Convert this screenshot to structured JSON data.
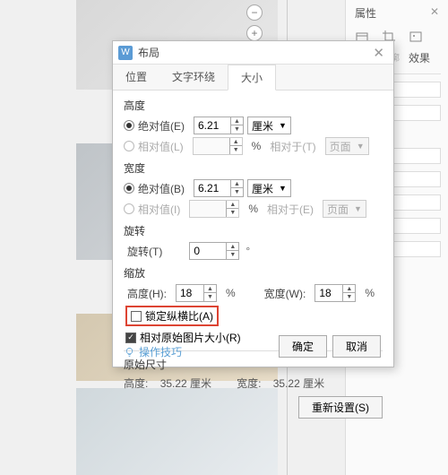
{
  "toolbar": {
    "zoom_out": "−",
    "zoom_in": "+"
  },
  "right_panel": {
    "header_prop": "属性",
    "header_close": "✕",
    "tab_fill": "填充与轮廓",
    "tab_effect": "效果"
  },
  "dialog": {
    "title": "布局",
    "close": "✕",
    "tabs": {
      "position": "位置",
      "wrap": "文字环绕",
      "size": "大小"
    },
    "height_section": {
      "label": "高度",
      "abs_label": "绝对值(E)",
      "abs_value": "6.21",
      "abs_unit": "厘米",
      "rel_label": "相对值(L)",
      "rel_unit": "%",
      "rel_to": "相对于(T)",
      "rel_target": "页面"
    },
    "width_section": {
      "label": "宽度",
      "abs_label": "绝对值(B)",
      "abs_value": "6.21",
      "abs_unit": "厘米",
      "rel_label": "相对值(I)",
      "rel_unit": "%",
      "rel_to": "相对于(E)",
      "rel_target": "页面"
    },
    "rotate_section": {
      "label": "旋转",
      "rot_label": "旋转(T)",
      "rot_value": "0",
      "deg": "°"
    },
    "scale_section": {
      "label": "缩放",
      "h_label": "高度(H):",
      "h_value": "18",
      "w_label": "宽度(W):",
      "w_value": "18",
      "unit": "%",
      "lock_ratio": "锁定纵横比(A)",
      "rel_orig": "相对原始图片大小(R)"
    },
    "orig_section": {
      "label": "原始尺寸",
      "h_label": "高度:",
      "h_value": "35.22 厘米",
      "w_label": "宽度:",
      "w_value": "35.22 厘米",
      "reset": "重新设置(S)"
    },
    "tips": "操作技巧",
    "ok": "确定",
    "cancel": "取消"
  }
}
